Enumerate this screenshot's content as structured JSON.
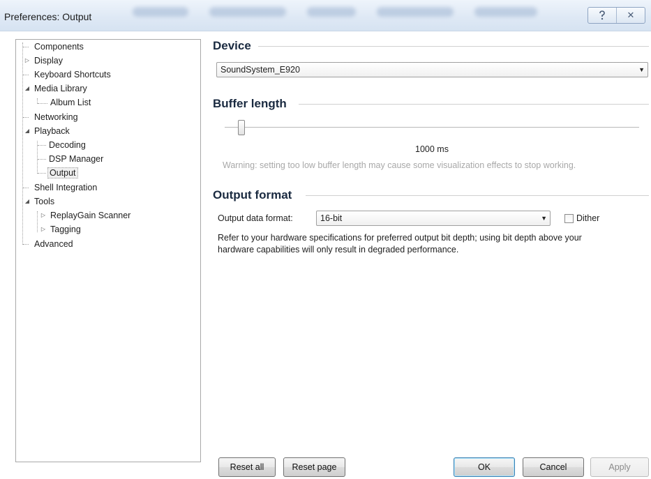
{
  "window": {
    "title": "Preferences: Output",
    "help_glyph": "⚖",
    "close_glyph": "✕"
  },
  "tree": {
    "items": [
      {
        "label": "Components"
      },
      {
        "label": "Display"
      },
      {
        "label": "Keyboard Shortcuts"
      },
      {
        "label": "Media Library"
      },
      {
        "label": "Album List"
      },
      {
        "label": "Networking"
      },
      {
        "label": "Playback"
      },
      {
        "label": "Decoding"
      },
      {
        "label": "DSP Manager"
      },
      {
        "label": "Output"
      },
      {
        "label": "Shell Integration"
      },
      {
        "label": "Tools"
      },
      {
        "label": "ReplayGain Scanner"
      },
      {
        "label": "Tagging"
      },
      {
        "label": "Advanced"
      }
    ]
  },
  "device": {
    "title": "Device",
    "selected": "SoundSystem_E920"
  },
  "buffer": {
    "title": "Buffer length",
    "value_text": "1000 ms",
    "warning": "Warning: setting too low buffer length may cause some visualization effects to stop working."
  },
  "output_format": {
    "title": "Output format",
    "label": "Output data format:",
    "selected": "16-bit",
    "dither_label": "Dither",
    "dither_checked": false,
    "note_line1": "Refer to your hardware specifications for preferred output bit depth; using bit depth above your",
    "note_line2": "hardware capabilities will only result in degraded performance."
  },
  "buttons": {
    "reset_all": "Reset all",
    "reset_page": "Reset page",
    "ok": "OK",
    "cancel": "Cancel",
    "apply": "Apply"
  }
}
